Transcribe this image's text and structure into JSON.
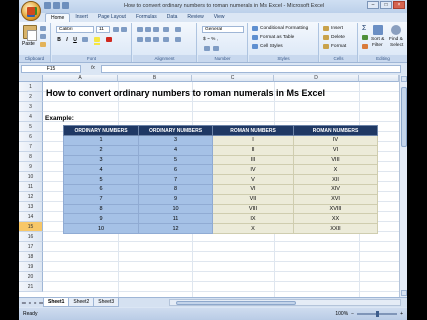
{
  "window": {
    "title": "How to convert ordinary numbers to roman numerals in Ms Excel - Microsoft Excel",
    "minimize": "–",
    "maximize": "□",
    "close": "×"
  },
  "tabs": [
    "Home",
    "Insert",
    "Page Layout",
    "Formulas",
    "Data",
    "Review",
    "View"
  ],
  "ribbon": {
    "clipboard": {
      "paste": "Paste",
      "label": "Clipboard"
    },
    "font": {
      "name": "Calibri",
      "size": "11",
      "bold": "B",
      "italic": "I",
      "underline": "U",
      "label": "Font"
    },
    "alignment": {
      "label": "Alignment"
    },
    "number": {
      "format": "General",
      "currency": "$ ~ % ,",
      "label": "Number"
    },
    "styles": {
      "conditional": "Conditional Formatting",
      "format_table": "Format as Table",
      "cell_styles": "Cell Styles",
      "label": "Styles"
    },
    "cells": {
      "insert": "Insert",
      "delete": "Delete",
      "format": "Format",
      "label": "Cells"
    },
    "editing": {
      "sum": "Σ",
      "sort": "Sort &",
      "filter": "Filter",
      "find": "Find &",
      "select": "Select",
      "label": "Editing"
    },
    "colors": {
      "highlight": "#f5e642",
      "fontcolor": "#d0281e",
      "styles_icon": "#5e8fd0",
      "cells_icon": "#c9a24a"
    }
  },
  "formula_bar": {
    "name_box": "F15",
    "fx": "fx",
    "content": ""
  },
  "columns": [
    "A",
    "B",
    "C",
    "D"
  ],
  "rows": [
    "1",
    "2",
    "3",
    "4",
    "5",
    "6",
    "7",
    "8",
    "9",
    "10",
    "11",
    "12",
    "13",
    "14",
    "15",
    "16",
    "17",
    "18",
    "19",
    "20",
    "21"
  ],
  "active_row": "15",
  "sheet": {
    "title": "How to convert ordinary numbers to roman numerals in Ms Excel",
    "example_label": "Example:",
    "table": {
      "headers": [
        "ORDINARY NUMBERS",
        "ORDINARY NUMBERS",
        "ROMAN NUMBERS",
        "ROMAN NUMBERS"
      ],
      "rows": [
        [
          "1",
          "3",
          "I",
          "IV"
        ],
        [
          "2",
          "4",
          "II",
          "VI"
        ],
        [
          "3",
          "5",
          "III",
          "VIII"
        ],
        [
          "4",
          "6",
          "IV",
          "X"
        ],
        [
          "5",
          "7",
          "V",
          "XII"
        ],
        [
          "6",
          "8",
          "VI",
          "XIV"
        ],
        [
          "7",
          "9",
          "VII",
          "XVI"
        ],
        [
          "8",
          "10",
          "VIII",
          "XVIII"
        ],
        [
          "9",
          "11",
          "IX",
          "XX"
        ],
        [
          "10",
          "12",
          "X",
          "XXII"
        ]
      ]
    }
  },
  "sheet_tabs": [
    "Sheet1",
    "Sheet2",
    "Sheet3"
  ],
  "active_sheet": "Sheet1",
  "status": {
    "text": "Ready",
    "zoom": "100%"
  }
}
